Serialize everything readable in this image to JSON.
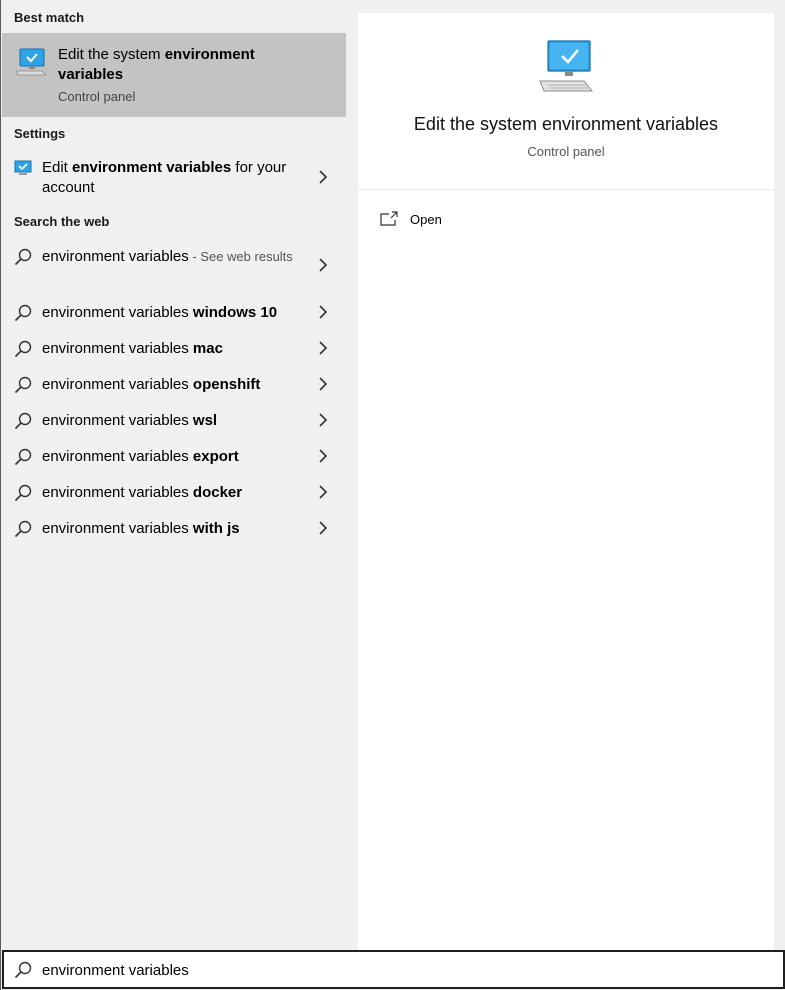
{
  "sections": {
    "best_match": "Best match",
    "settings": "Settings",
    "search_web": "Search the web"
  },
  "best_match": {
    "title_plain": "Edit the system ",
    "title_bold": "environment",
    "title_line2": "variables",
    "subtitle": "Control panel",
    "icon": "computer-check-icon"
  },
  "settings_item": {
    "text_plain1": "Edit ",
    "text_bold": "environment variables",
    "text_plain2": " for your account",
    "icon": "monitor-check-icon"
  },
  "web_items": [
    {
      "plain": "environment variables",
      "bold": "",
      "hint": " - See web results"
    },
    {
      "plain": "environment variables ",
      "bold": "windows 10",
      "hint": ""
    },
    {
      "plain": "environment variables ",
      "bold": "mac",
      "hint": ""
    },
    {
      "plain": "environment variables ",
      "bold": "openshift",
      "hint": ""
    },
    {
      "plain": "environment variables ",
      "bold": "wsl",
      "hint": ""
    },
    {
      "plain": "environment variables ",
      "bold": "export",
      "hint": ""
    },
    {
      "plain": "environment variables ",
      "bold": "docker",
      "hint": ""
    },
    {
      "plain": "environment variables ",
      "bold": "with js",
      "hint": ""
    }
  ],
  "details": {
    "title": "Edit the system environment variables",
    "subtitle": "Control panel",
    "open_label": "Open"
  },
  "search": {
    "value": "environment variables"
  },
  "colors": {
    "selected_bg": "#c3c3c3",
    "pane_bg": "#f0f0f0",
    "accent": "#1e90d6"
  }
}
